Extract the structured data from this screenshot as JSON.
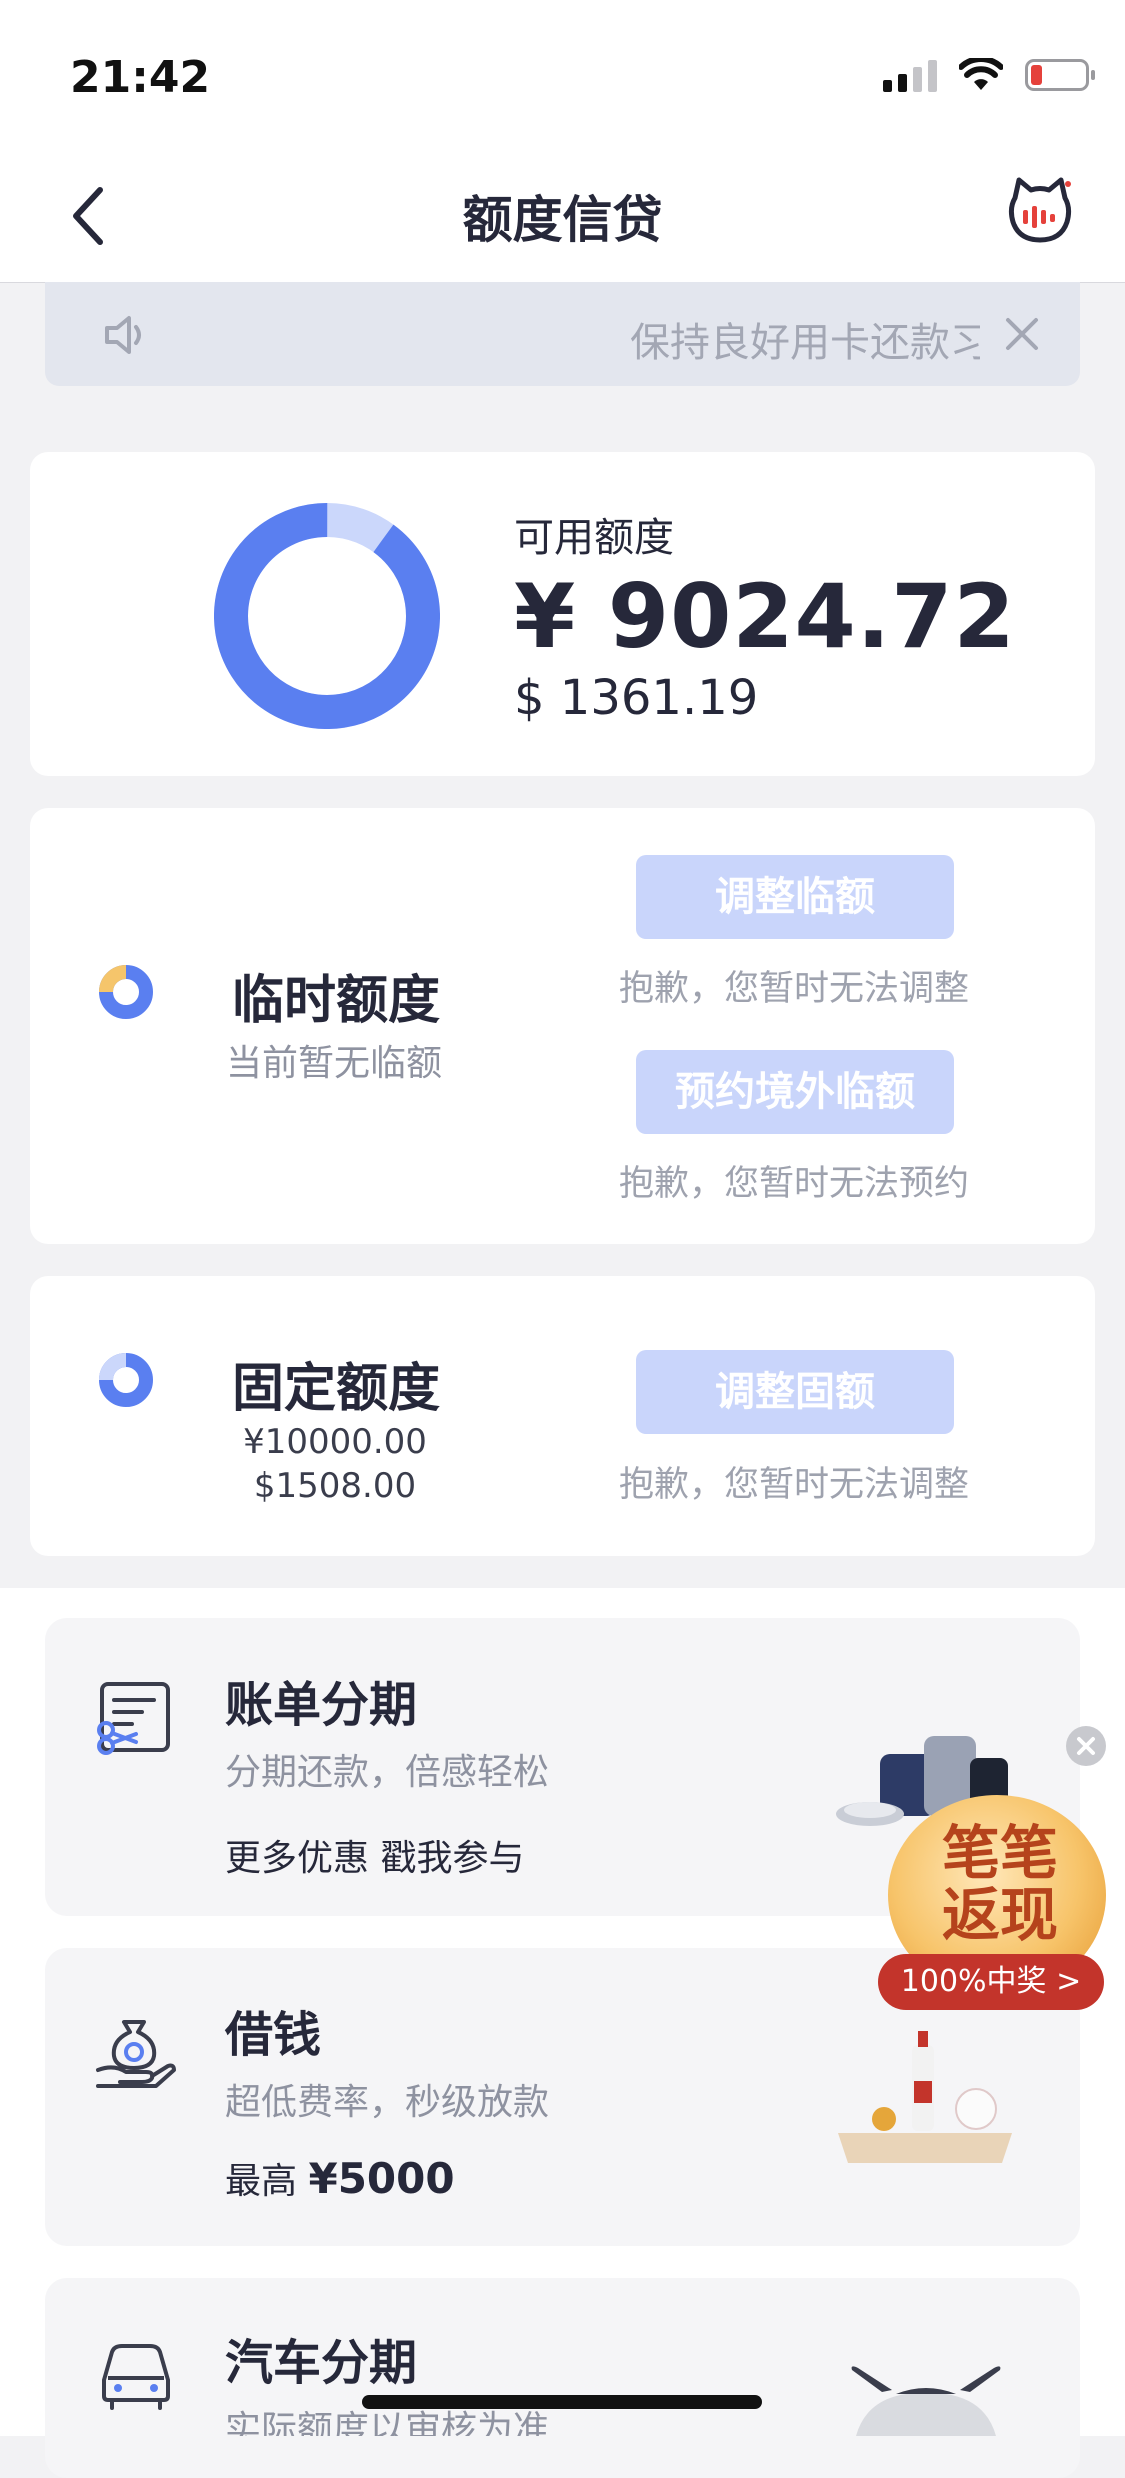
{
  "status_bar": {
    "time": "21:42"
  },
  "nav": {
    "title": "额度信贷"
  },
  "notice": {
    "text": "保持良好用卡还款习惯"
  },
  "available": {
    "label": "可用额度",
    "cny": "¥ 9024.72",
    "usd": "$ 1361.19",
    "ring_fraction": 0.9
  },
  "temporary": {
    "title": "临时额度",
    "sub": "当前暂无临额",
    "adjust_button": "调整临额",
    "adjust_note": "抱歉，您暂时无法调整",
    "reserve_button": "预约境外临额",
    "reserve_note": "抱歉，您暂时无法预约"
  },
  "fixed": {
    "title": "固定额度",
    "cny": "¥10000.00",
    "usd": "$1508.00",
    "adjust_button": "调整固额",
    "adjust_note": "抱歉，您暂时无法调整"
  },
  "services": [
    {
      "title": "账单分期",
      "sub": "分期还款，倍感轻松",
      "extra": "更多优惠 戳我参与"
    },
    {
      "title": "借钱",
      "sub": "超低费率，秒级放款",
      "extra_prefix": "最高",
      "extra_value": "¥5000"
    },
    {
      "title": "汽车分期",
      "sub": "实际额度以审核为准"
    }
  ],
  "promo": {
    "title_line1": "笔笔",
    "title_line2": "返现",
    "badge": "100%中奖 >"
  },
  "colors": {
    "accent": "#5a7ff0",
    "pill_disabled": "#c9d5fb",
    "promo_red": "#c3342b"
  }
}
